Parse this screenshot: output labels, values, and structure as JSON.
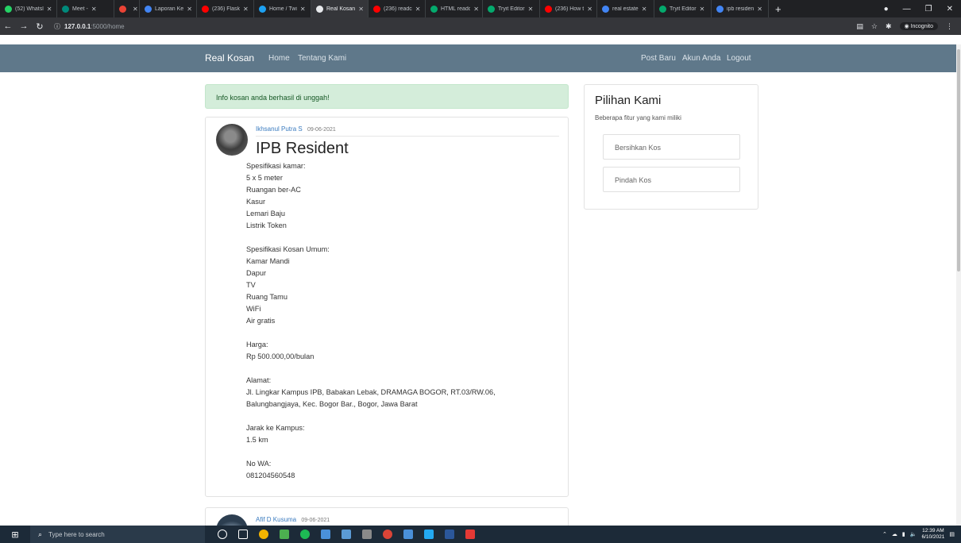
{
  "browser": {
    "tabs": [
      {
        "title": "(52) Whatsl",
        "color": "#25d366",
        "active": false
      },
      {
        "title": "Meet -",
        "color": "#00897b",
        "active": false
      },
      {
        "title": "",
        "color": "#ea4335",
        "active": false
      },
      {
        "title": "Laporan Ke",
        "color": "#4285f4",
        "active": false
      },
      {
        "title": "(236) Flask",
        "color": "#ff0000",
        "active": false
      },
      {
        "title": "Home / Twi",
        "color": "#1da1f2",
        "active": false
      },
      {
        "title": "Real Kosan",
        "color": "#e8eaed",
        "active": true
      },
      {
        "title": "(236) readc",
        "color": "#ff0000",
        "active": false
      },
      {
        "title": "HTML readc",
        "color": "#04aa6d",
        "active": false
      },
      {
        "title": "Tryit Editor",
        "color": "#04aa6d",
        "active": false
      },
      {
        "title": "(236) How t",
        "color": "#ff0000",
        "active": false
      },
      {
        "title": "real estate",
        "color": "#4285f4",
        "active": false
      },
      {
        "title": "Tryit Editor",
        "color": "#04aa6d",
        "active": false
      },
      {
        "title": "ipb residen",
        "color": "#4285f4",
        "active": false
      }
    ],
    "url_host": "127.0.0.1",
    "url_path": ":5000/home",
    "incognito_label": "Incognito"
  },
  "navbar": {
    "brand": "Real Kosan",
    "links_left": [
      "Home",
      "Tentang Kami"
    ],
    "links_right": [
      "Post Baru",
      "Akun Anda",
      "Logout"
    ]
  },
  "alert": {
    "message": "Info kosan anda berhasil di unggah!"
  },
  "posts": [
    {
      "author": "Ikhsanul Putra S",
      "date": "09-06-2021",
      "title": "IPB Resident",
      "lines": [
        "Spesifikasi kamar:",
        "5 x 5 meter",
        "Ruangan ber-AC",
        "Kasur",
        "Lemari Baju",
        "Listrik Token",
        "",
        "Spesifikasi Kosan Umum:",
        "Kamar Mandi",
        "Dapur",
        "TV",
        "Ruang Tamu",
        "WiFi",
        "Air gratis",
        "",
        "Harga:",
        "Rp 500.000,00/bulan",
        "",
        "Alamat:",
        "Jl. Lingkar Kampus IPB, Babakan Lebak, DRAMAGA BOGOR, RT.03/RW.06,",
        "Balungbangjaya, Kec. Bogor Bar., Bogor, Jawa Barat",
        "",
        "Jarak ke Kampus:",
        "1.5 km",
        "",
        "No WA:",
        "081204560548"
      ]
    },
    {
      "author": "Afif D Kusuma",
      "date": "09-06-2021"
    }
  ],
  "sidebar": {
    "title": "Pilihan Kami",
    "subtitle": "Beberapa fitur yang kami miliki",
    "items": [
      "Bersihkan Kos",
      "Pindah Kos"
    ]
  },
  "taskbar": {
    "search_placeholder": "Type here to search",
    "time": "12:39 AM",
    "date": "6/10/2021"
  }
}
